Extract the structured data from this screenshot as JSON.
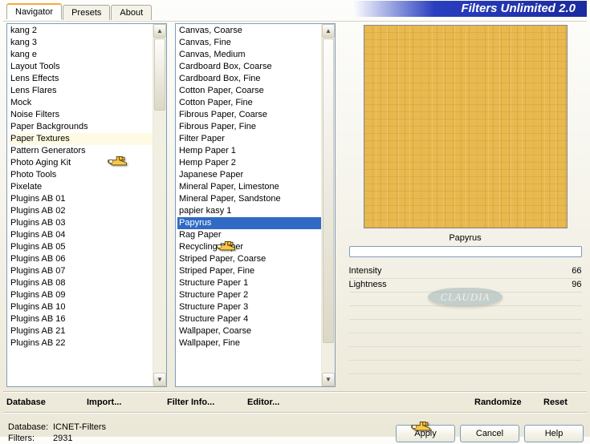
{
  "title": "Filters Unlimited 2.0",
  "tabs": {
    "navigator": "Navigator",
    "presets": "Presets",
    "about": "About"
  },
  "categories": [
    "kang 2",
    "kang 3",
    "kang e",
    "Layout Tools",
    "Lens Effects",
    "Lens Flares",
    "Mock",
    "Noise Filters",
    "Paper Backgrounds",
    "Paper Textures",
    "Pattern Generators",
    "Photo Aging Kit",
    "Photo Tools",
    "Pixelate",
    "Plugins AB 01",
    "Plugins AB 02",
    "Plugins AB 03",
    "Plugins AB 04",
    "Plugins AB 05",
    "Plugins AB 06",
    "Plugins AB 07",
    "Plugins AB 08",
    "Plugins AB 09",
    "Plugins AB 10",
    "Plugins AB 16",
    "Plugins AB 21",
    "Plugins AB 22"
  ],
  "selected_category_index": 9,
  "filters": [
    "Canvas, Coarse",
    "Canvas, Fine",
    "Canvas, Medium",
    "Cardboard Box, Coarse",
    "Cardboard Box, Fine",
    "Cotton Paper, Coarse",
    "Cotton Paper, Fine",
    "Fibrous Paper, Coarse",
    "Fibrous Paper, Fine",
    "Filter Paper",
    "Hemp Paper 1",
    "Hemp Paper 2",
    "Japanese Paper",
    "Mineral Paper, Limestone",
    "Mineral Paper, Sandstone",
    "papier kasy 1",
    "Papyrus",
    "Rag Paper",
    "Recycling Paper",
    "Striped Paper, Coarse",
    "Striped Paper, Fine",
    "Structure Paper 1",
    "Structure Paper 2",
    "Structure Paper 3",
    "Structure Paper 4",
    "Wallpaper, Coarse",
    "Wallpaper, Fine"
  ],
  "selected_filter_index": 16,
  "preview_label": "Papyrus",
  "sliders": {
    "intensity_label": "Intensity",
    "intensity_value": "66",
    "lightness_label": "Lightness",
    "lightness_value": "96"
  },
  "toolbar": {
    "database": "Database",
    "import": "Import...",
    "filter_info": "Filter Info...",
    "editor": "Editor...",
    "randomize": "Randomize",
    "reset": "Reset"
  },
  "status": {
    "db_label": "Database:",
    "db_value": "ICNET-Filters",
    "filters_label": "Filters:",
    "filters_value": "2931"
  },
  "buttons": {
    "apply": "Apply",
    "cancel": "Cancel",
    "help": "Help"
  },
  "watermark": "CLAUDIA"
}
